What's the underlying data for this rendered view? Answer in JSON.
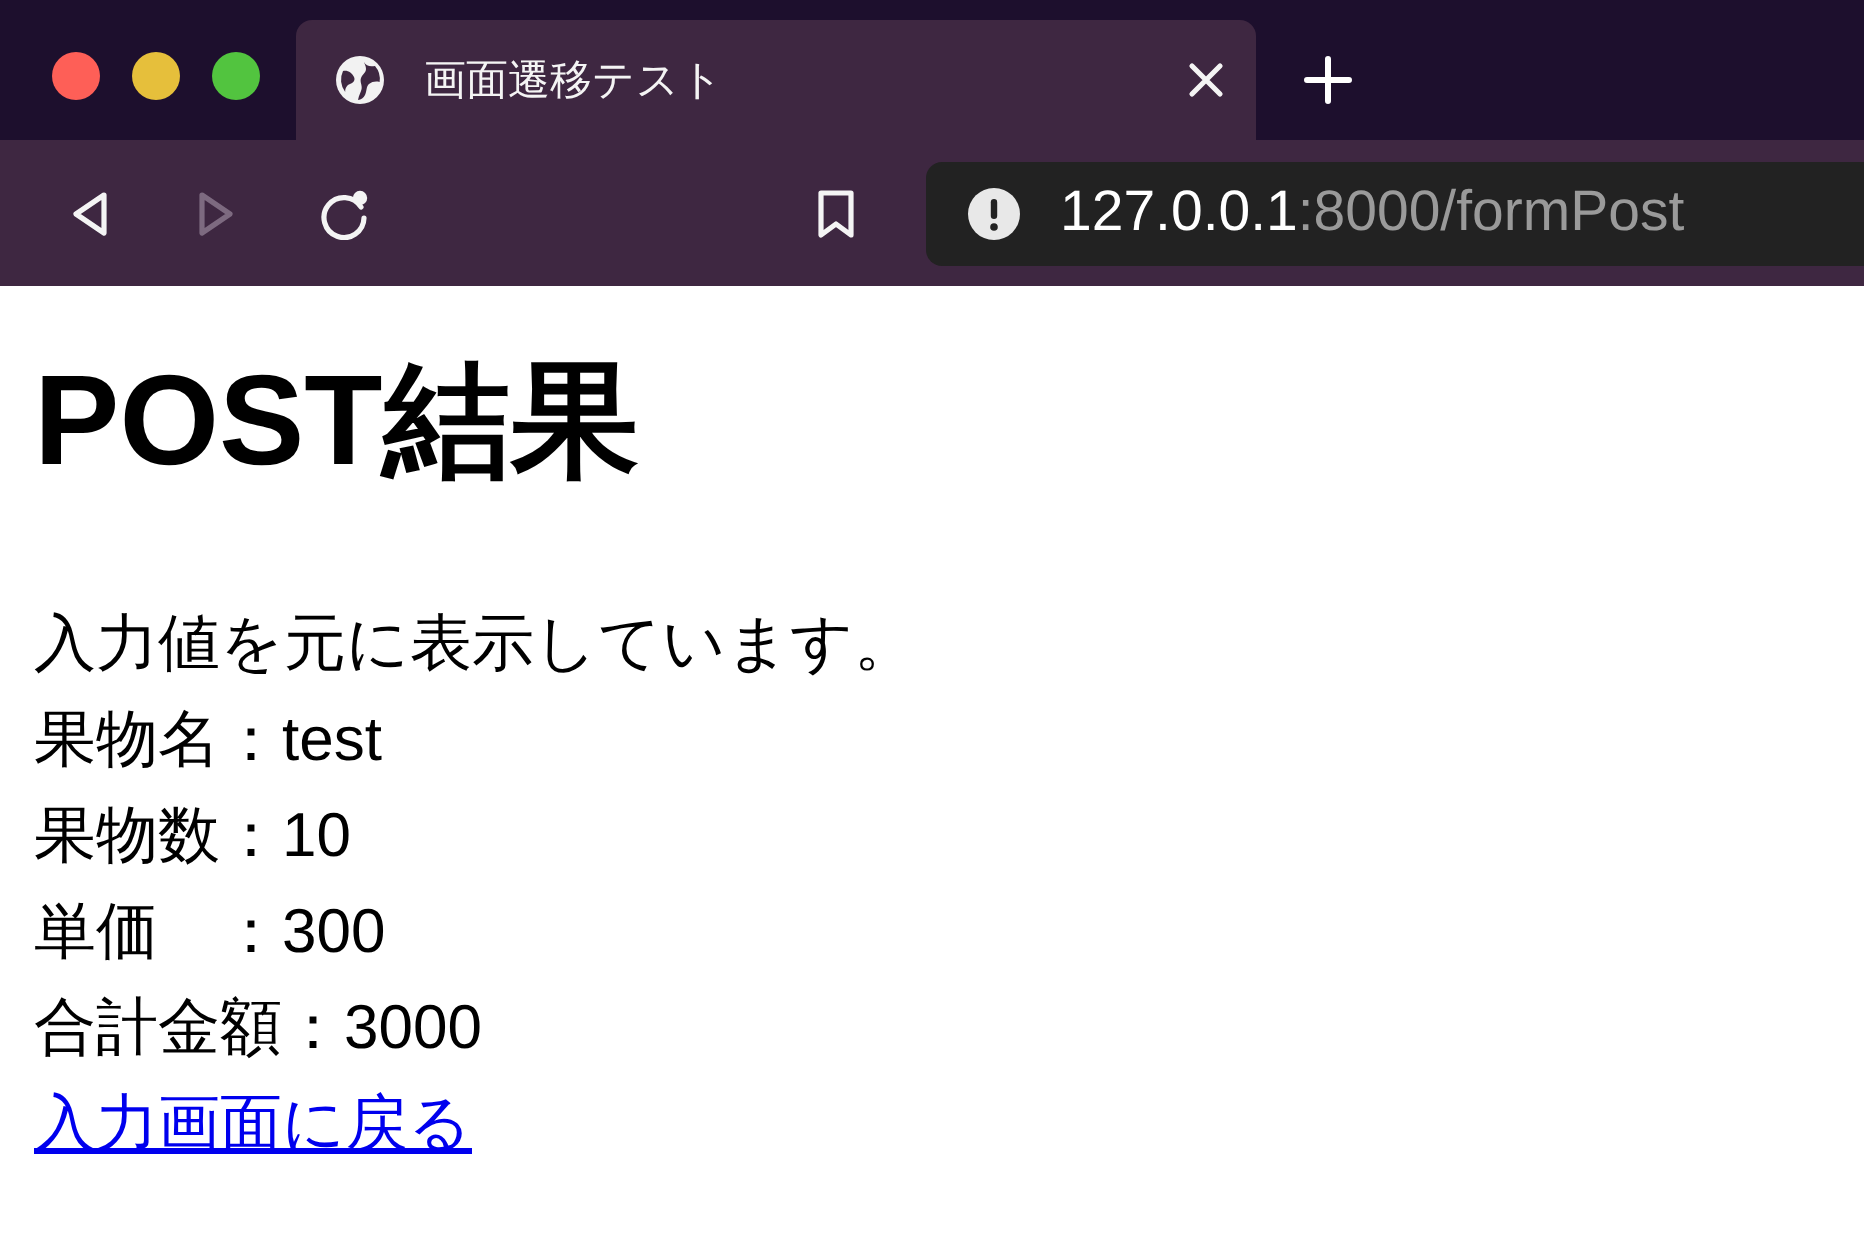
{
  "tabs": [
    {
      "title": "画面遷移テスト",
      "selected": true
    }
  ],
  "toolbar": {
    "back": {
      "disabled": false
    },
    "forward": {
      "disabled": true
    },
    "address": {
      "host": "127.0.0.1",
      "path": ":8000/formPost"
    }
  },
  "page": {
    "heading": "POST結果",
    "lines": [
      "入力値を元に表示しています。",
      "果物名：test",
      "果物数：10",
      "単価　：300",
      "合計金額：3000"
    ],
    "link": "入力画面に戻る"
  }
}
